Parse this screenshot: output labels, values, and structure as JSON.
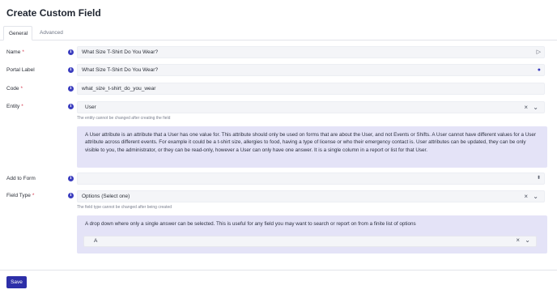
{
  "page": {
    "title": "Create Custom Field"
  },
  "tabs": [
    {
      "label": "General",
      "active": true
    },
    {
      "label": "Advanced",
      "active": false
    }
  ],
  "form": {
    "name": {
      "label": "Name",
      "required": "*",
      "value": "What Size T-Shirt Do You Wear?",
      "icon": "translate-icon"
    },
    "portal_label": {
      "label": "Portal Label",
      "value": "What Size T-Shirt Do You Wear?",
      "icon": "globe-icon"
    },
    "code": {
      "label": "Code",
      "required": "*",
      "value": "what_size_t-shirt_do_you_wear"
    },
    "entity": {
      "label": "Entity",
      "required": "*",
      "value": "User",
      "helper": "The entity cannot be changed after creating the field",
      "description": "A User attribute is an attribute that a User has one value for. This attribute should only be used on forms that are about the User, and not Events or Shifts. A User cannot have different values for a User attribute across different events. For example it could be a t-shirt size, allergies to food, having a type of license or who their emergency contact is. User attributes can be updated, they can be only visible to you, the administrator, or they can be read-only, however a User can only have one answer. It is a single column in a report or list for that User."
    },
    "add_to_form": {
      "label": "Add to Form",
      "value": ""
    },
    "field_type": {
      "label": "Field Type",
      "required": "*",
      "value": "Options (Select one)",
      "helper": "The field type cannot be changed after being created",
      "description": "A drop down where only a single answer can be selected. This is useful for any field you may want to search or report on from a finite list of options",
      "option_value": "A"
    }
  },
  "footer": {
    "save_label": "Save"
  },
  "colors": {
    "accent": "#2d2fa8",
    "info_icon": "#3b3dbf",
    "required": "#d43a4e",
    "info_panel": "#e4e3f7"
  }
}
